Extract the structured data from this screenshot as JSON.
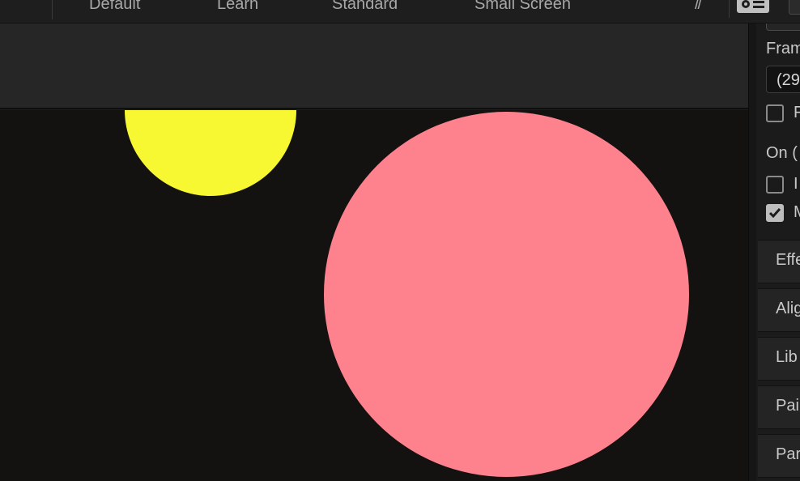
{
  "workspace_bar": {
    "tabs": [
      "Default",
      "Learn",
      "Standard",
      "Small Screen"
    ],
    "more_icon": "double-chevron-right-icon",
    "settings_icon": "workspace-settings-icon"
  },
  "canvas": {
    "background": "#141111",
    "shapes": [
      {
        "name": "yellow-circle",
        "color": "#f7f832"
      },
      {
        "name": "pink-circle",
        "color": "#fe828d"
      }
    ]
  },
  "right_panel": {
    "frame_label": "Fram",
    "frame_value": "(29",
    "checkbox_1_label": "F",
    "on_label": "On (",
    "checkbox_2_label": "I",
    "checkbox_3_label": "M",
    "checkbox_3_checked": true,
    "collapsed_panels": [
      "Effe",
      "Alig",
      "Lib",
      "Pai",
      "Par"
    ]
  }
}
